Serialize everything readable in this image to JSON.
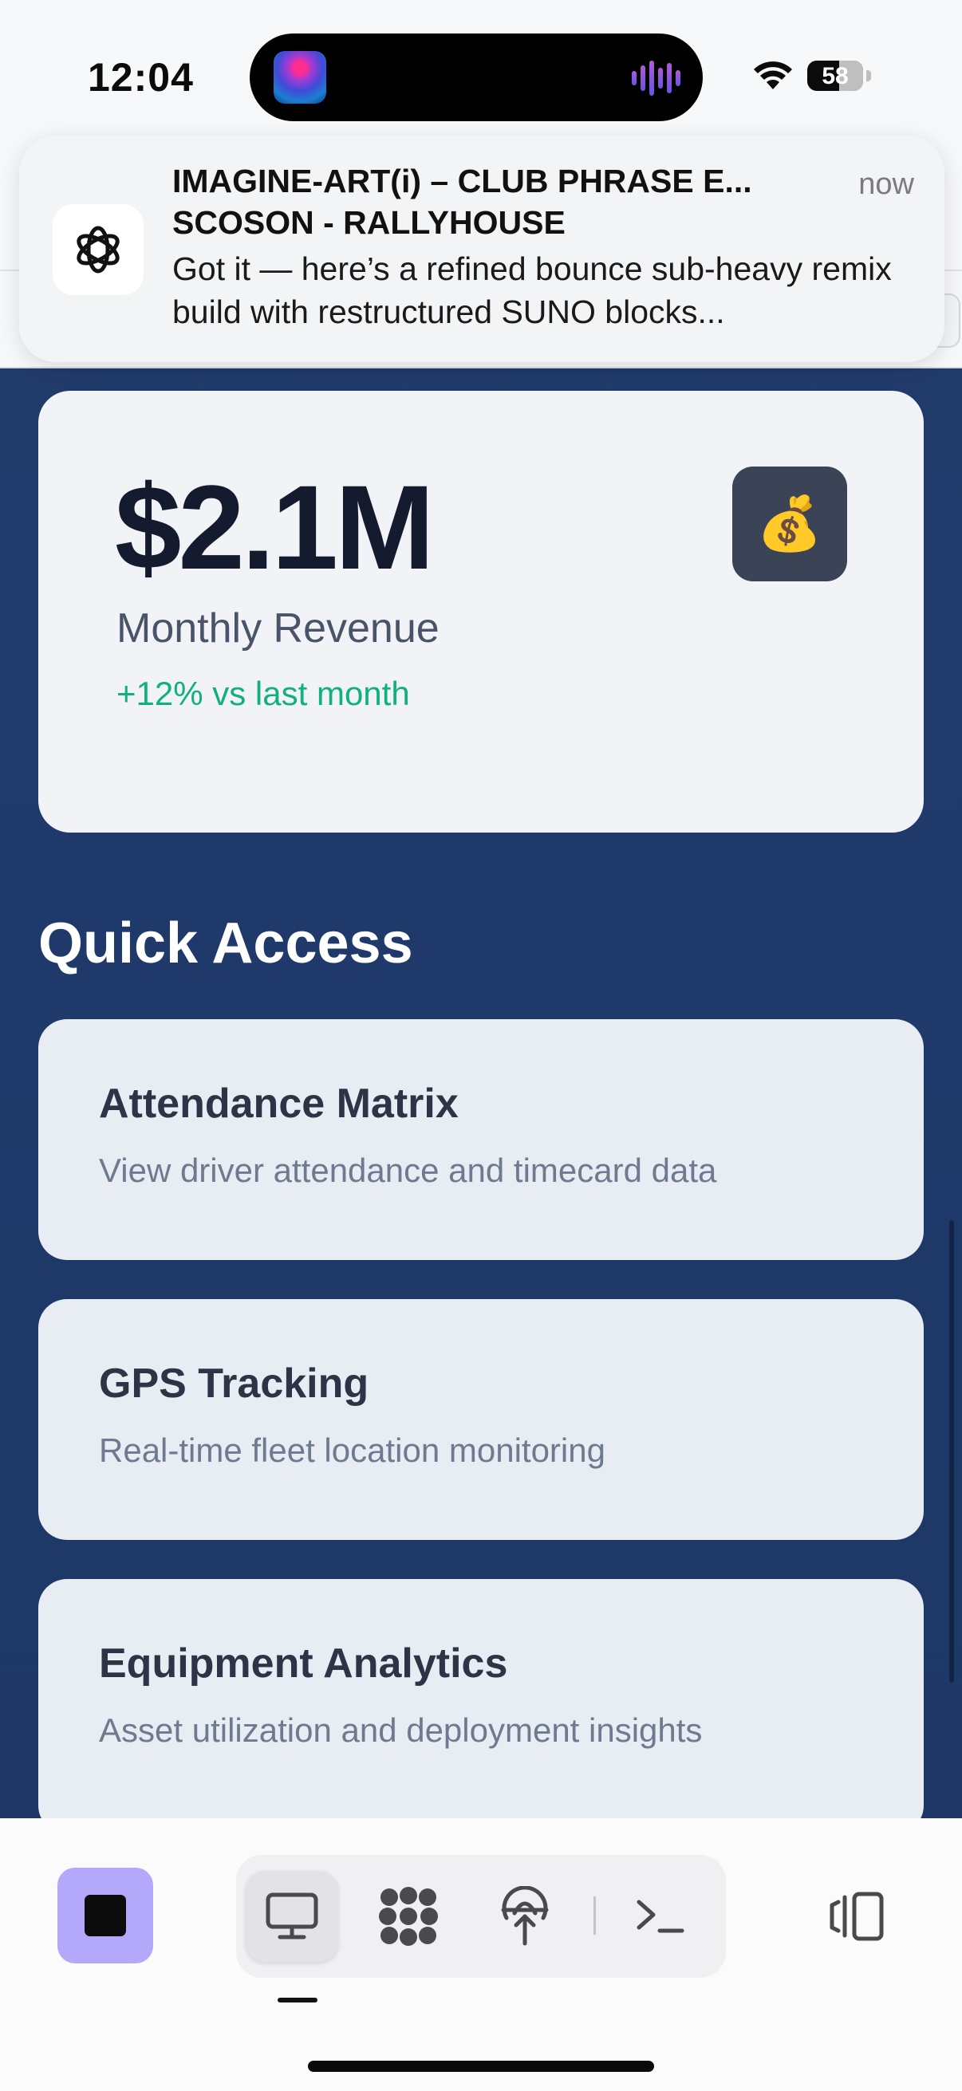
{
  "status_bar": {
    "time": "12:04",
    "battery": "58"
  },
  "notification": {
    "app_icon": "chatgpt-icon",
    "title": "IMAGINE-ART(i) – CLUB PHRASE E...",
    "subtitle": "SCOSON - RALLYHOUSE",
    "body": "Got it — here’s a refined bounce sub-heavy remix build with restructured SUNO blocks...",
    "time": "now"
  },
  "revenue_card": {
    "value": "$2.1M",
    "label": "Monthly Revenue",
    "change": "+12% vs last month",
    "icon": "money-bag-icon",
    "icon_glyph": "💰",
    "accent_color": "#12b07a"
  },
  "quick_access": {
    "title": "Quick Access",
    "items": [
      {
        "title": "Attendance Matrix",
        "description": "View driver attendance and timecard data"
      },
      {
        "title": "GPS Tracking",
        "description": "Real-time fleet location monitoring"
      },
      {
        "title": "Equipment Analytics",
        "description": "Asset utilization and deployment insights"
      }
    ]
  },
  "toolbar": {
    "stop_color": "#b4a8fa",
    "tools": [
      "desktop-icon",
      "apps-grid-icon",
      "network-upload-icon",
      "terminal-icon"
    ],
    "panel": "sidebar-panel-icon"
  }
}
